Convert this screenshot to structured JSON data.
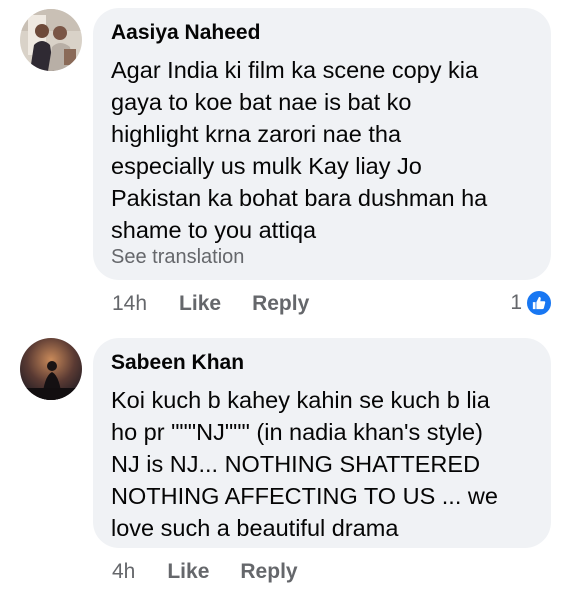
{
  "comments": [
    {
      "author": "Aasiya Naheed",
      "text": "Agar India ki film ka scene copy kia\ngaya to koe bat nae is bat ko\nhighlight krna zarori nae tha\nespecially us mulk Kay liay Jo\nPakistan ka bohat bara dushman ha\nshame to you attiqa",
      "see_translation": "See translation",
      "time": "14h",
      "like_label": "Like",
      "reply_label": "Reply",
      "reaction_count": "1",
      "reaction_icon": "thumbs-up-icon"
    },
    {
      "author": "Sabeen Khan",
      "text": "Koi kuch b kahey kahin se kuch b lia\nho pr \"\"\"NJ\"\"\" (in nadia khan's style)\nNJ is NJ... NOTHING SHATTERED\nNOTHING AFFECTING TO US ... we\nlove such a beautiful drama",
      "time": "4h",
      "like_label": "Like",
      "reply_label": "Reply"
    }
  ],
  "colors": {
    "bubble_bg": "#f0f2f5",
    "secondary_text": "#65676b",
    "like_blue": "#1877f2"
  }
}
